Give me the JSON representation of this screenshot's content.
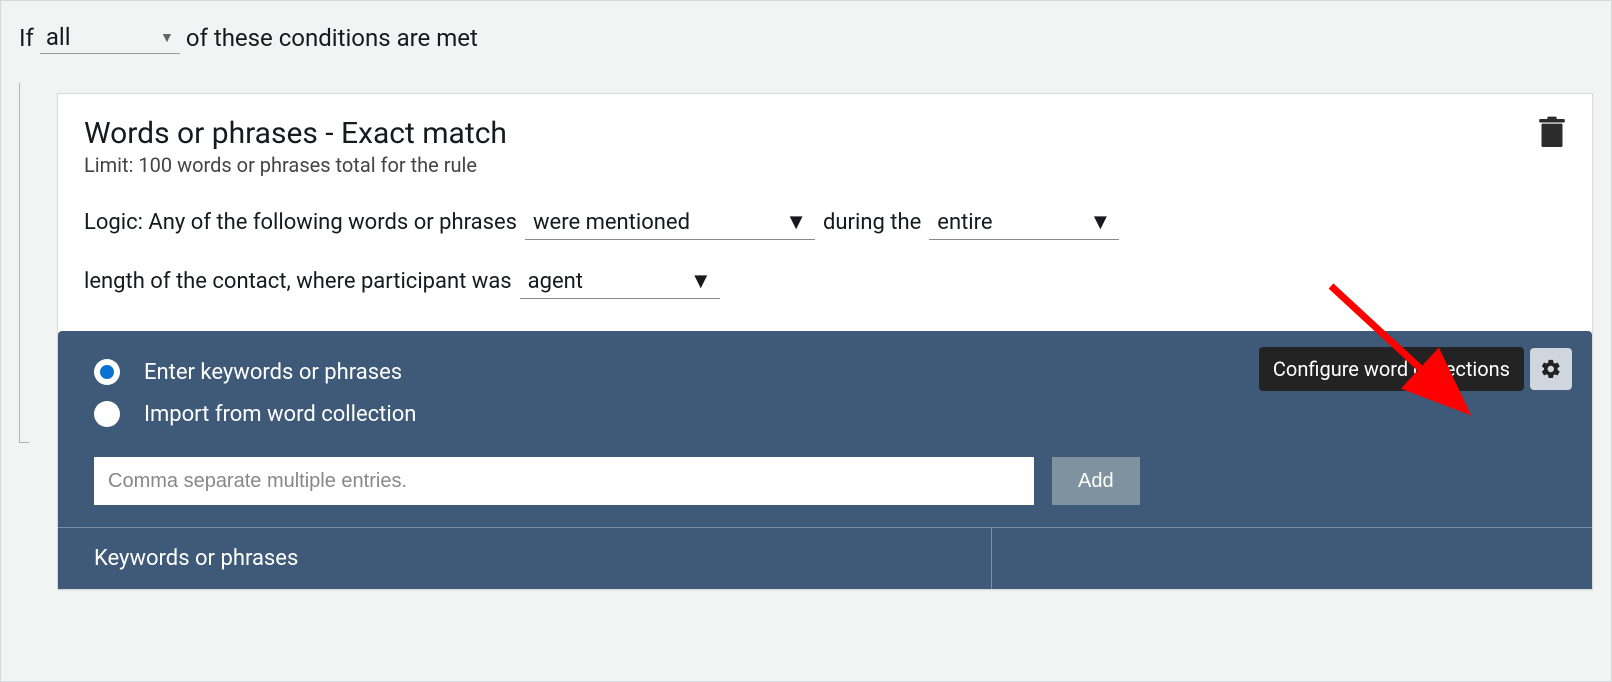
{
  "condition_line": {
    "prefix": "If",
    "quantifier": "all",
    "suffix": "of these conditions are met"
  },
  "card": {
    "title": "Words or phrases - Exact match",
    "subtitle": "Limit: 100 words or phrases total for the rule",
    "logic": {
      "prefix": "Logic: Any of the following words or phrases",
      "mentioned_select": "were mentioned",
      "middle": "during the",
      "scope_select": "entire",
      "second_line_prefix": "length of the contact, where participant was",
      "participant_select": "agent"
    }
  },
  "panel": {
    "radios": {
      "enter": "Enter keywords or phrases",
      "import": "Import from word collection"
    },
    "tooltip": "Configure word collections",
    "input_placeholder": "Comma separate multiple entries.",
    "add_button": "Add",
    "keywords_header": "Keywords or phrases"
  }
}
